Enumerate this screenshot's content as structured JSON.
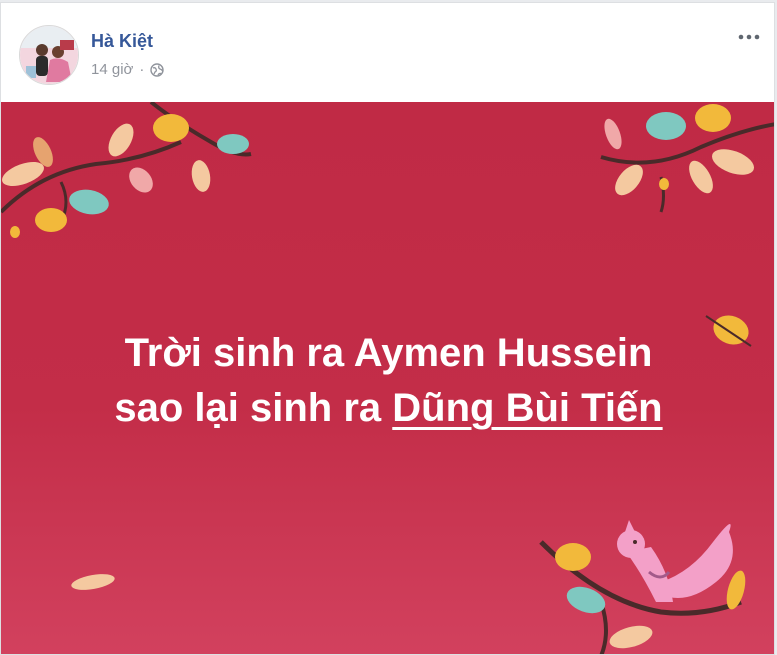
{
  "post": {
    "author": "Hà Kiệt",
    "time": "14 giờ",
    "separator": "·",
    "privacy_icon": "globe-icon",
    "menu_icon": "more-options-icon",
    "status": {
      "line1": "Trời sinh ra Aymen Hussein",
      "line2_prefix": "sao lại sinh ra",
      "mention": "Dũng Bùi Tiến"
    },
    "colors": {
      "banner": "#c02a45",
      "author_link": "#365899",
      "meta_text": "#90949c"
    }
  }
}
